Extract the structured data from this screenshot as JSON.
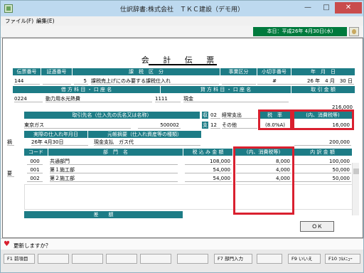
{
  "window": {
    "title": "仕訳辞書:株式会社　ＴＫＣ建設（デモ用）"
  },
  "menu": {
    "file": "ファイル(F)",
    "edit": "編集(E)"
  },
  "toolbar": {
    "date": "本日：平成26年 4月30日(水)"
  },
  "document": {
    "title": "会 計 伝 票"
  },
  "header_labels": {
    "voucher_no": "伝票番号",
    "evidence_no": "証憑番号",
    "tax_class": "課　税　区　分",
    "business_class": "事業区分",
    "check_no": "小切手番号",
    "year_month_day": "年　月　日",
    "debit": "借 方 科 目 ・ 口 座 名",
    "credit": "貸 方 科 目 ・ 口 座 名",
    "amount": "取 引 金 額",
    "partner": "取引先名（仕入先の氏名又は名称）",
    "tax_rate": "税　率",
    "tax_included": "(内、消費税等)",
    "purchase_date": "実際の仕入れ年月日",
    "summary": "元帳摘要（仕入れ資産等の種類）",
    "dept_code": "コード",
    "dept_name": "部　門　名",
    "tax_incl_amount": "税 込 み 金 額",
    "tax_incl_sub": "(内、消費税等)",
    "inner_amount": "内 訳 金 額",
    "diff": "差　　額",
    "side_receive": "収",
    "side_pay": "支",
    "side_summary": "摘",
    "side_dept": "要"
  },
  "voucher": {
    "voucher_no": "144",
    "tax_code": "5",
    "tax_desc": "課税売上げにのみ要する課税仕入れ",
    "check_no": "#",
    "date": "26 年　4 月　30 日",
    "debit_code": "0224",
    "debit_name": "動力用水光熱費",
    "credit_code": "1111",
    "credit_name": "現金",
    "amount": "216,000",
    "partner_name": "東京ガス",
    "partner_code": "500002",
    "receive_code": "02",
    "receive_name": "経常支出",
    "pay_code": "12",
    "pay_name": "その他",
    "tax_rate": "(8.0%A)",
    "tax_amount": "16,000",
    "purchase_date": "26年 4月30日",
    "summary_text": "現金支払　ガス代",
    "summary_amount": "200,000"
  },
  "departments": [
    {
      "code": "000",
      "name": "共通部門",
      "amount": "108,000",
      "tax": "8,000",
      "inner": "100,000"
    },
    {
      "code": "001",
      "name": "第１施工部",
      "amount": "54,000",
      "tax": "4,000",
      "inner": "50,000"
    },
    {
      "code": "002",
      "name": "第２施工部",
      "amount": "54,000",
      "tax": "4,000",
      "inner": "50,000"
    }
  ],
  "ok_button": "ＯＫ",
  "status": "更新しますか？",
  "fkeys": {
    "f1": "F1 前項目",
    "f7": "F7 部門入力",
    "f9": "F9 いいえ",
    "f10": "F10 ﾌﾙﾒﾆｭｰ"
  },
  "colors": {
    "header_teal": "#1d7c86",
    "highlight_red": "#d9202f",
    "status_green": "#007a3d"
  }
}
